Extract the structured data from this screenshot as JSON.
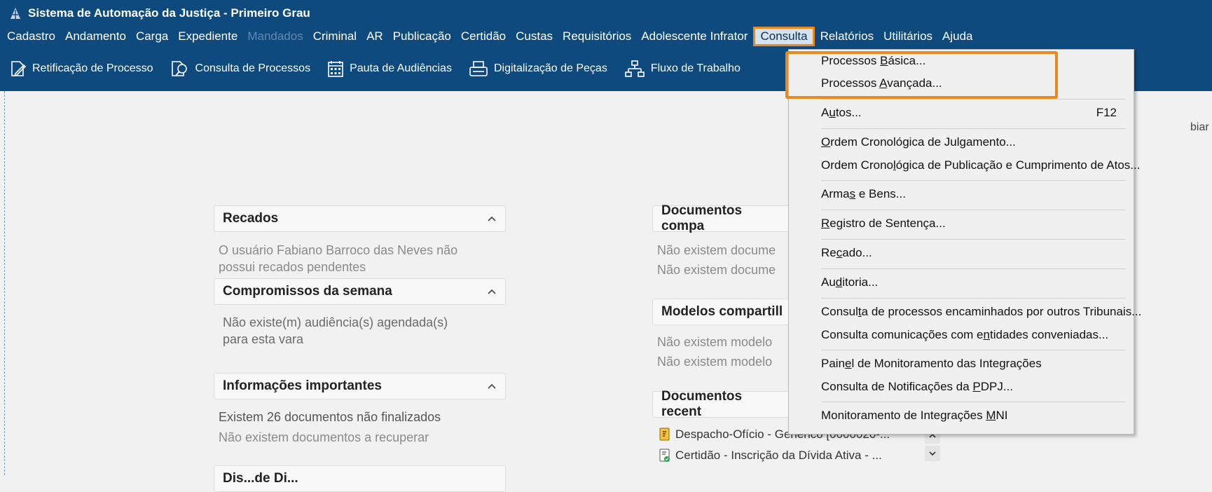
{
  "window": {
    "title": "Sistema de Automação da Justiça - Primeiro Grau"
  },
  "menubar": {
    "items": [
      "Cadastro",
      "Andamento",
      "Carga",
      "Expediente",
      "Mandados",
      "Criminal",
      "AR",
      "Publicação",
      "Certidão",
      "Custas",
      "Requisitórios",
      "Adolescente Infrator",
      "Consulta",
      "Relatórios",
      "Utilitários",
      "Ajuda"
    ]
  },
  "toolbar": {
    "retificacao": "Retificação de Processo",
    "consulta": "Consulta de Processos",
    "pauta": "Pauta de Audiências",
    "digitalizacao": "Digitalização de Peças",
    "fluxo": "Fluxo de Trabalho"
  },
  "panels": {
    "recados": {
      "title": "Recados",
      "line1": "O usuário Fabiano Barroco das Neves não",
      "line2": "possui recados pendentes"
    },
    "compromissos": {
      "title": "Compromissos da semana",
      "line1": "Não existe(m) audiência(s) agendada(s)",
      "line2": "para esta vara"
    },
    "informacoes": {
      "title": "Informações importantes",
      "line1": "Existem 26 documentos não finalizados",
      "line2": "Não existem documentos a recuperar"
    },
    "bottom": {
      "title": "Dis...de Di..."
    },
    "documentos_comp": {
      "title": "Documentos compa",
      "line1": "Não existem docume",
      "line2": "Não existem docume"
    },
    "modelos": {
      "title": "Modelos compartill",
      "line1": "Não existem modelo",
      "line2": "Não existem modelo"
    },
    "recentes": {
      "title": "Documentos recent",
      "doc1": "Despacho-Ofício - Genérico [0000020-...",
      "doc2": "Certidão - Inscrição da Dívida Ativa - ..."
    },
    "right_cutoff": "biar"
  },
  "dropdown": {
    "basica": {
      "pre": "Processos ",
      "ul": "B",
      "post": "ásica..."
    },
    "avancada": {
      "pre": "Processos ",
      "ul": "A",
      "post": "vançada..."
    },
    "autos": {
      "pre": "A",
      "ul": "u",
      "post": "tos...",
      "shortcut": "F12"
    },
    "ordem": {
      "pre": "",
      "ul": "O",
      "post": "rdem Cronológica de Julgamento..."
    },
    "ordem_pub": {
      "pre": "Ordem Crono",
      "ul": "l",
      "post": "ógica de Publicação e Cumprimento de Atos..."
    },
    "armas": {
      "pre": "Arma",
      "ul": "s",
      "post": " e Bens..."
    },
    "registro": {
      "pre": "",
      "ul": "R",
      "post": "egistro de Sentença..."
    },
    "recado": {
      "pre": "Re",
      "ul": "c",
      "post": "ado..."
    },
    "auditoria": {
      "pre": "Au",
      "ul": "d",
      "post": "itoria..."
    },
    "consulta_trib": {
      "pre": "Consul",
      "ul": "t",
      "post": "a de processos encaminhados por outros Tribunais..."
    },
    "consulta_com": {
      "pre": "Consulta comunicações com e",
      "ul": "n",
      "post": "tidades conveniadas..."
    },
    "painel": {
      "pre": "Pain",
      "ul": "e",
      "post": "l de Monitoramento das Integrações"
    },
    "notificacoes": {
      "pre": "Consulta de Notificações da ",
      "ul": "P",
      "post": "DPJ..."
    },
    "mni": {
      "pre": "Monitoramento de Integrações ",
      "ul": "M",
      "post": "NI"
    }
  },
  "colors": {
    "brand": "#0f4a7e",
    "accent": "#e88a1e"
  }
}
